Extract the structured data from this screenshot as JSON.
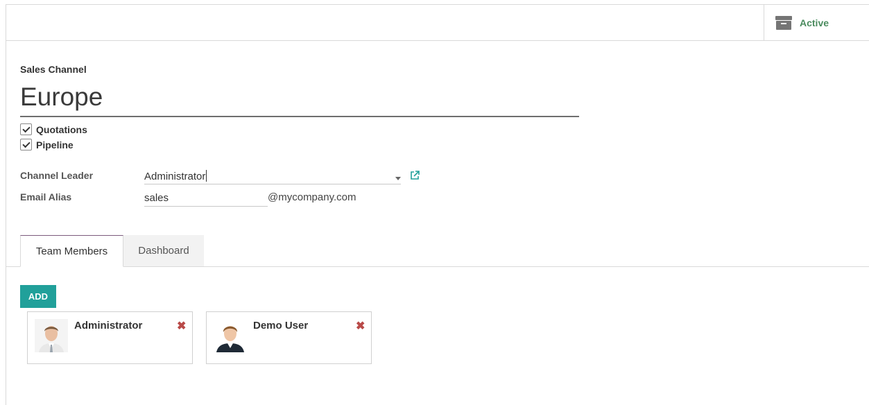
{
  "button_box": {
    "active_label": "Active",
    "active_icon": "archive-icon"
  },
  "form": {
    "channel_label": "Sales Channel",
    "channel_name": "Europe",
    "checkboxes": [
      {
        "label": "Quotations",
        "checked": true
      },
      {
        "label": "Pipeline",
        "checked": true
      }
    ],
    "leader_label": "Channel Leader",
    "leader_value": "Administrator",
    "alias_label": "Email Alias",
    "alias_value": "sales",
    "alias_domain": "@mycompany.com"
  },
  "tabs": [
    {
      "label": "Team Members",
      "active": true
    },
    {
      "label": "Dashboard",
      "active": false
    }
  ],
  "members": {
    "add_label": "ADD",
    "items": [
      {
        "name": "Administrator",
        "remove": "✖"
      },
      {
        "name": "Demo User",
        "remove": "✖"
      }
    ]
  },
  "colors": {
    "accent": "#21a09a",
    "active_text": "#4a8b5e",
    "remove": "#b94a48",
    "tab_border": "#7b5a7d"
  }
}
